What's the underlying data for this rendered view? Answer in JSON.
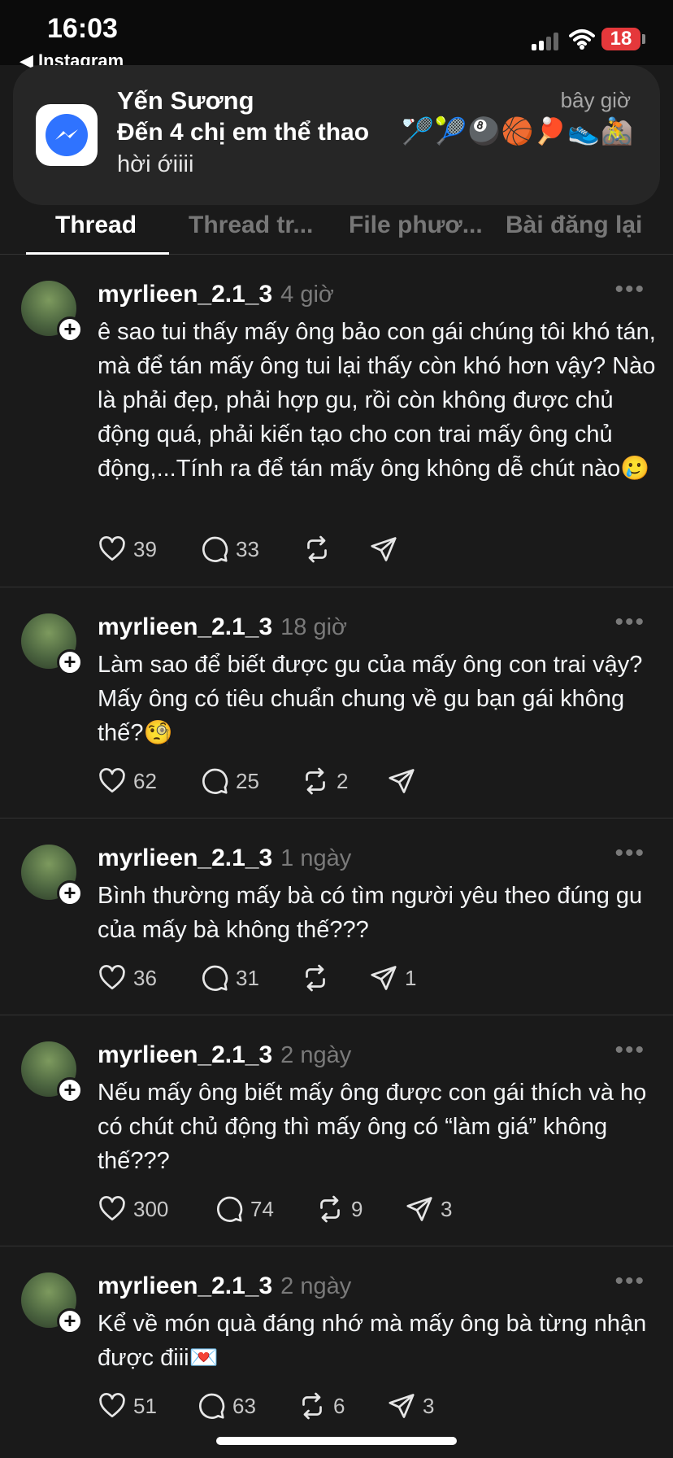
{
  "status_bar": {
    "time": "16:03",
    "back_app": "◀ Instagram",
    "battery": "18"
  },
  "notification": {
    "sender": "Yến Sương",
    "time": "bây giờ",
    "group": "Đến 4 chị em thể thao",
    "emojis": "🏸🎾🎱🏀🏓👟🚵",
    "message": "hời ớiiii"
  },
  "tabs": [
    "Thread",
    "Thread tr...",
    "File phươ...",
    "Bài đăng lại"
  ],
  "posts": [
    {
      "username": "myrlieen_2.1_3",
      "age": "4 giờ",
      "text": "ê sao tui thấy mấy ông bảo con gái chúng tôi khó tán, mà để tán mấy ông tui lại thấy còn khó hơn vậy? Nào là phải đẹp, phải hợp gu, rồi còn không được chủ động quá, phải kiến tạo cho con trai mấy ông chủ động,...Tính ra để tán mấy ông không dễ chút nào🥲",
      "likes": "39",
      "replies": "33",
      "reposts": "",
      "shares": ""
    },
    {
      "username": "myrlieen_2.1_3",
      "age": "18 giờ",
      "text": "Làm sao để biết được gu của mấy ông con trai vậy? Mấy ông có tiêu chuẩn chung về gu bạn gái không thế?🧐",
      "likes": "62",
      "replies": "25",
      "reposts": "2",
      "shares": ""
    },
    {
      "username": "myrlieen_2.1_3",
      "age": "1 ngày",
      "text": "Bình thường mấy bà có tìm người yêu theo đúng gu của mấy bà không thế???",
      "likes": "36",
      "replies": "31",
      "reposts": "",
      "shares": "1"
    },
    {
      "username": "myrlieen_2.1_3",
      "age": "2 ngày",
      "text": "Nếu mấy ông biết mấy ông được con gái thích và họ có chút chủ động thì mấy ông có “làm giá” không thế???",
      "likes": "300",
      "replies": "74",
      "reposts": "9",
      "shares": "3"
    },
    {
      "username": "myrlieen_2.1_3",
      "age": "2 ngày",
      "text": "Kể về món quà đáng nhớ mà mấy ông bà từng nhận được điii💌",
      "likes": "51",
      "replies": "63",
      "reposts": "6",
      "shares": "3"
    }
  ],
  "colors": {
    "background": "#1a1a1a",
    "notification": "#262626",
    "messenger_blue": "#2f73ff",
    "muted": "#7a7a7a",
    "battery": "#e5383b"
  }
}
